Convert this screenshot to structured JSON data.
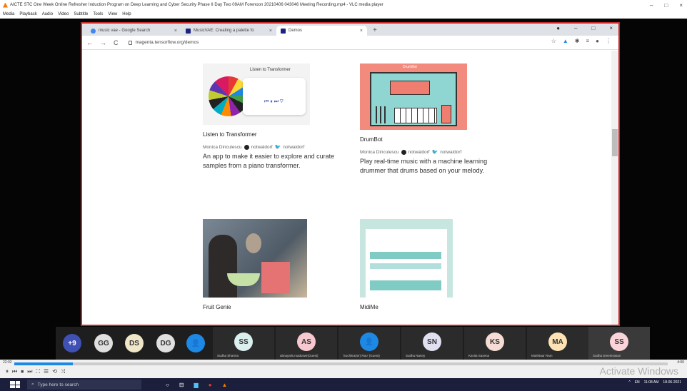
{
  "vlc": {
    "title": "AICTE STC One Week Online Refresher Induction Program on Deep Learning and Cyber Security Phase II Day Two 09AM Forenoon 20210406 043046 Meeting Recording.mp4 - VLC media player",
    "window_controls": [
      "–",
      "□",
      "×"
    ],
    "menu": [
      "Media",
      "Playback",
      "Audio",
      "Video",
      "Subtitle",
      "Tools",
      "View",
      "Help"
    ],
    "time_elapsed": "22:02",
    "time_total": "4:00",
    "progress_fraction": 0.09,
    "controls": [
      "⏸",
      "⏮",
      "⏹",
      "⏭",
      "⛶",
      "☰",
      "⟲",
      "⤨"
    ]
  },
  "chrome": {
    "tabs": [
      {
        "label": "music vae - Google Search",
        "favicon_color": "#4285f4"
      },
      {
        "label": "MusicVAE: Creating a palette fo",
        "favicon_color": "#1a237e"
      },
      {
        "label": "Demos",
        "favicon_color": "#1a237e"
      }
    ],
    "tab_close": "×",
    "new_tab": "+",
    "window_controls": [
      "●",
      "–",
      "□",
      "×"
    ],
    "nav": {
      "back": "←",
      "forward": "→",
      "reload": "C"
    },
    "url": "magenta.tensorflow.org/demos",
    "toolbar_icons": [
      "☆",
      "▲",
      "✱",
      "≡",
      "●",
      "⋮"
    ]
  },
  "demos": [
    {
      "title": "Listen to Transformer",
      "authors": [
        "Monica Dinculescu",
        "notwaldorf",
        "notwaldorf"
      ],
      "description": "An app to make it easier to explore and curate samples from a piano transformer.",
      "thumb_caption": "Listen to Transformer",
      "thumb_bg": "#f3f3f3"
    },
    {
      "title": "DrumBot",
      "authors": [
        "Monica Dinculescu",
        "notwaldorf",
        "notwaldorf"
      ],
      "description": "Play real-time music with a machine learning drummer that drums based on your melody.",
      "thumb_caption": "DrumBot",
      "thumb_bg": "#f28b7d"
    },
    {
      "title": "Fruit Genie",
      "authors": [],
      "description": "",
      "thumb_caption": "",
      "thumb_bg": "#6d7b8a"
    },
    {
      "title": "MidiMe",
      "authors": [],
      "description": "",
      "thumb_caption": "",
      "thumb_bg": "#c8e6e0"
    }
  ],
  "participants": [
    {
      "initials": "+9",
      "name": "",
      "color": "#3f51b5",
      "text_color": "#fff"
    },
    {
      "initials": "GG",
      "name": "",
      "color": "#e0e0e0",
      "text_color": "#333"
    },
    {
      "initials": "DS",
      "name": "",
      "color": "#f0e6c8",
      "text_color": "#333"
    },
    {
      "initials": "DG",
      "name": "",
      "color": "#e0e0e0",
      "text_color": "#333"
    },
    {
      "initials": "",
      "name": "",
      "color": "#1e88e5",
      "text_color": "#fff"
    },
    {
      "initials": "SS",
      "name": "Sudha Sharma",
      "color": "#d9f0ee",
      "text_color": "#333"
    },
    {
      "initials": "AS",
      "name": "abnayalis.maduswr(Guest)",
      "color": "#f8c8d0",
      "text_color": "#333"
    },
    {
      "initials": "",
      "name": "'Suchitra(sir) Rao' (Guest)",
      "color": "#1e88e5",
      "text_color": "#fff"
    },
    {
      "initials": "SN",
      "name": "Sudha Nanny",
      "color": "#e0e0f0",
      "text_color": "#333"
    },
    {
      "initials": "KS",
      "name": "Kavita Saxena",
      "color": "#f5dcd5",
      "text_color": "#333"
    },
    {
      "initials": "MA",
      "name": "Mukhtaar Ram",
      "color": "#fde2b5",
      "text_color": "#333"
    },
    {
      "initials": "SS",
      "name": "Sudha Sreenivasan",
      "color": "#fad4d8",
      "text_color": "#333"
    }
  ],
  "activate_watermark": "Activate Windows",
  "taskbar": {
    "search_placeholder": "Type here to search",
    "icons": [
      "○",
      "⊟",
      "▆",
      "●",
      "▲"
    ],
    "tray": [
      "^",
      "EN",
      "11:08 AM",
      "18-06-2021"
    ]
  }
}
